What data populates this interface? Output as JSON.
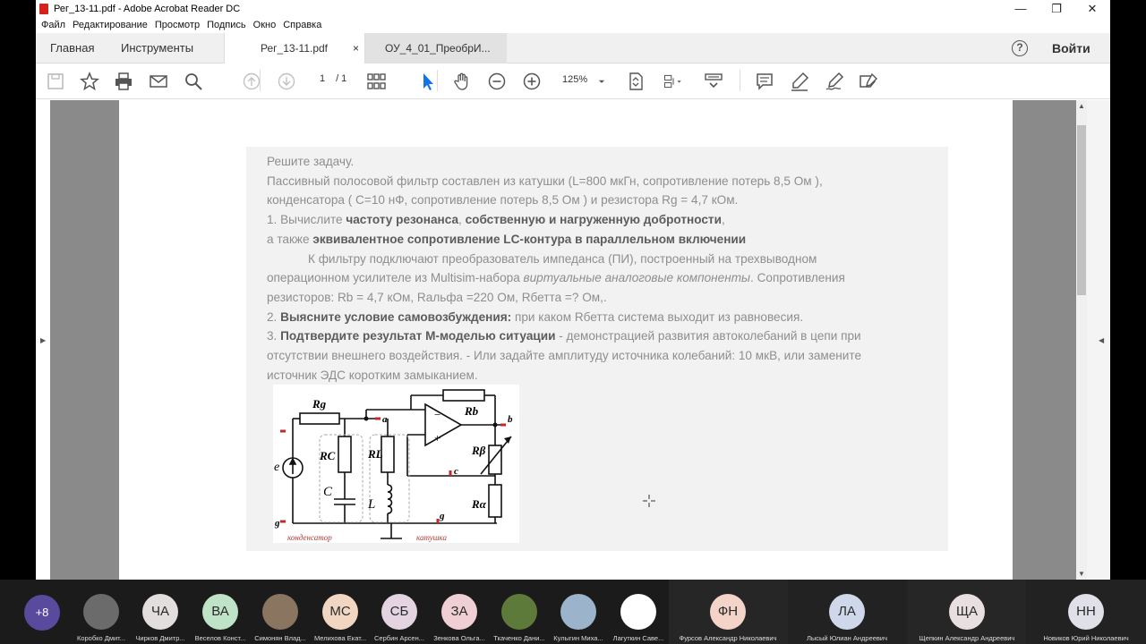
{
  "window": {
    "title": "Рег_13-11.pdf - Adobe Acrobat Reader DC",
    "controls": [
      "—",
      "❐",
      "✕"
    ]
  },
  "menu": [
    "Файл",
    "Редактирование",
    "Просмотр",
    "Подпись",
    "Окно",
    "Справка"
  ],
  "tabs": {
    "home": "Главная",
    "tools": "Инструменты",
    "doc1": "Рег_13-11.pdf",
    "doc2": "ОУ_4_01_ПреобрИ...",
    "close": "×"
  },
  "help_label": "?",
  "signin": "Войти",
  "toolbar": {
    "page_current": "1",
    "page_total": "/ 1",
    "zoom": "125%"
  },
  "document": {
    "heading": "Решите задачу.",
    "line1": "Пассивный полосовой фильтр составлен из катушки (L=800 мкГн, сопротивление потерь 8,5 Ом ),",
    "line2": "конденсатора ( C=10 нФ, сопротивление потерь 8,5 Ом ) и резистора Rg = 4,7 кОм.",
    "q1_prefix": "1. Вычислите ",
    "q1_bold": "частоту резонанса",
    "q1_mid": ", ",
    "q1_bold2": "собственную и нагруженную добротности",
    "q1_end": ",",
    "q1b_prefix": "а также ",
    "q1b_bold": "эквивалентное сопротивление LC-контура в параллельном включении",
    "p2_line1": "К фильтру подключают преобразователь импеданса (ПИ), построенный на трехвыводном",
    "p2_line2a": "операционном усилителе из Multisim-набора ",
    "p2_line2i": "виртуальные аналоговые компоненты",
    "p2_line2b": ". Сопротивления",
    "p2_line3": "резисторов: Rb = 4,7 кОм, Rальфа =220 Ом, Rбетта =? Ом,.",
    "q2_prefix": "2. ",
    "q2_bold": "Выясните условие самовозбуждения:",
    "q2_end": " при каком Rбетта система выходит из равновесия.",
    "q3_prefix": "3. ",
    "q3_bold": "Подтвердите результат М-моделью ситуации",
    "q3_end": " - демонстрацией развития автоколебаний в цепи при",
    "q3_line2": "отсутствии внешнего воздействия. - Или задайте амплитуду источника колебаний: 10 мкВ, или замените",
    "q3_line3": "источник ЭДС коротким замыканием."
  },
  "circuit": {
    "labels": {
      "rg": "Rg",
      "rb": "Rb",
      "rc": "RC",
      "rl": "RL",
      "rbeta": "Rβ",
      "ralpha": "Rα",
      "c": "C",
      "l": "L",
      "e": "e",
      "a": "a",
      "b": "b",
      "cnode": "c",
      "g1": "g",
      "g2": "g",
      "cap_caption": "конденсатор",
      "coil_caption": "катушка"
    }
  },
  "participants": {
    "more": "+8",
    "list": [
      {
        "initials": "",
        "name": "Коробко Дмит...",
        "color": "#6b6b6b"
      },
      {
        "initials": "ЧА",
        "name": "Чирков Дмитр...",
        "color": "#e2dedd"
      },
      {
        "initials": "ВА",
        "name": "Веселов Конст...",
        "color": "#bfe3c6"
      },
      {
        "initials": "",
        "name": "Симонян Влад...",
        "color": "#8a7560"
      },
      {
        "initials": "МС",
        "name": "Мелихова Екат...",
        "color": "#f1d6c1"
      },
      {
        "initials": "СБ",
        "name": "Сербин Арсен...",
        "color": "#e4d4e2"
      },
      {
        "initials": "ЗА",
        "name": "Зенкова Ольга...",
        "color": "#f0cfd4"
      },
      {
        "initials": "",
        "name": "Ткаченко Дани...",
        "color": "#5e7a3a"
      },
      {
        "initials": "",
        "name": "Кулыгин Миха...",
        "color": "#9bb4cc"
      },
      {
        "initials": "",
        "name": "Лагуткин Саве...",
        "color": "#ffffff"
      }
    ],
    "big": [
      {
        "initials": "ФН",
        "name": "Фурсов Александр Николаевич",
        "color": "#f4d3c8"
      },
      {
        "initials": "ЛА",
        "name": "Лысый Юлиан Андреевич",
        "color": "#cfd8ea"
      },
      {
        "initials": "ЩА",
        "name": "Щепкин Александр Андреевич",
        "color": "#e8e0e0"
      },
      {
        "initials": "НН",
        "name": "Новиков Юрий Николаевич",
        "color": "#e0e0e8"
      }
    ]
  }
}
